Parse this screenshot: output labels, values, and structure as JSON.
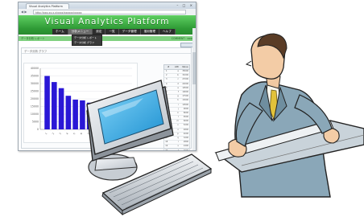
{
  "browser": {
    "tab_title": "Visual Analytics Platform",
    "url": "http://xxx.xx.x.x/xxxx/xxxxxx/xxxxx",
    "window_controls": "– □ ×",
    "nav_arrows": "◀ ▶"
  },
  "app": {
    "title": "Visual Analytics Platform",
    "menu": [
      "ホーム",
      "分析メニュー",
      "設定",
      "一覧",
      "データ管理",
      "運用管理",
      "ヘルプ"
    ],
    "active_menu_index": 1,
    "dropdown_items": [
      "データ分析 レポート",
      "データ分析 グラフ"
    ],
    "greenbar_left": "データ分析 レポート",
    "greenbar_right": "COMMENT : xxxx",
    "panel_title": "データ分析 グラフ",
    "table_headers": [
      "#",
      "Attr",
      "Value"
    ],
    "table_rows": [
      [
        "1",
        "a",
        "35000"
      ],
      [
        "2",
        "b",
        "31000"
      ],
      [
        "3",
        "c",
        "27000"
      ],
      [
        "4",
        "d",
        "22000"
      ],
      [
        "5",
        "e",
        "19500"
      ],
      [
        "6",
        "f",
        "19000"
      ],
      [
        "7",
        "g",
        "17500"
      ],
      [
        "8",
        "h",
        "13000"
      ],
      [
        "9",
        "i",
        "10500"
      ],
      [
        "10",
        "j",
        "9000"
      ],
      [
        "11",
        "k",
        "8000"
      ],
      [
        "12",
        "l",
        "6500"
      ],
      [
        "13",
        "m",
        "6000"
      ],
      [
        "14",
        "n",
        "5200"
      ],
      [
        "15",
        "o",
        "4800"
      ],
      [
        "16",
        "p",
        "4000"
      ],
      [
        "17",
        "q",
        "3200"
      ],
      [
        "18",
        "r",
        "2800"
      ],
      [
        "19",
        "s",
        "2400"
      ],
      [
        "20",
        "t",
        "2000"
      ],
      [
        "21",
        "u",
        "1800"
      ],
      [
        "22",
        "v",
        "1500"
      ],
      [
        "23",
        "w",
        "1200"
      ]
    ]
  },
  "colors": {
    "banner_green": "#3aae3f",
    "bar_blue": "#2a17d6",
    "monitor_cyan": "#3ab0e8",
    "suit": "#7f9bab"
  },
  "chart_data": {
    "type": "bar",
    "title": "",
    "xlabel": "",
    "ylabel": "",
    "ylim": [
      0,
      40000
    ],
    "y_ticks": [
      "40000",
      "35000",
      "30000",
      "25000",
      "20000",
      "15000",
      "10000",
      "5000",
      "0"
    ],
    "categories": [
      "1",
      "2",
      "3",
      "4",
      "5",
      "6",
      "7",
      "8",
      "9",
      "10",
      "11"
    ],
    "values": [
      35000,
      31000,
      27000,
      22000,
      19500,
      19000,
      17500,
      13000,
      10500,
      9000,
      8000
    ],
    "grid": true,
    "legend": "none"
  }
}
